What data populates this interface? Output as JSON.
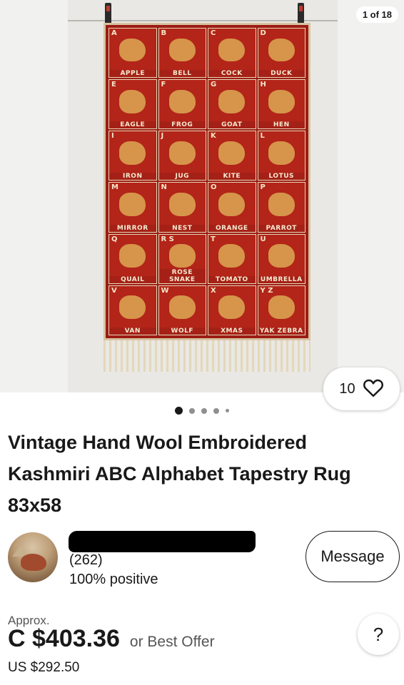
{
  "gallery": {
    "counter": "1 of 18",
    "rug_cells": [
      {
        "letter": "A",
        "word": "APPLE"
      },
      {
        "letter": "B",
        "word": "BELL"
      },
      {
        "letter": "C",
        "word": "COCK"
      },
      {
        "letter": "D",
        "word": "DUCK"
      },
      {
        "letter": "E",
        "word": "EAGLE"
      },
      {
        "letter": "F",
        "word": "FROG"
      },
      {
        "letter": "G",
        "word": "GOAT"
      },
      {
        "letter": "H",
        "word": "HEN"
      },
      {
        "letter": "I",
        "word": "IRON"
      },
      {
        "letter": "J",
        "word": "JUG"
      },
      {
        "letter": "K",
        "word": "KITE"
      },
      {
        "letter": "L",
        "word": "LOTUS"
      },
      {
        "letter": "M",
        "word": "MIRROR"
      },
      {
        "letter": "N",
        "word": "NEST"
      },
      {
        "letter": "O",
        "word": "ORANGE"
      },
      {
        "letter": "P",
        "word": "PARROT"
      },
      {
        "letter": "Q",
        "word": "QUAIL"
      },
      {
        "letter": "R S",
        "word": "ROSE SNAKE"
      },
      {
        "letter": "T",
        "word": "TOMATO"
      },
      {
        "letter": "U",
        "word": "UMBRELLA"
      },
      {
        "letter": "V",
        "word": "VAN"
      },
      {
        "letter": "W",
        "word": "WOLF"
      },
      {
        "letter": "X",
        "word": "XMAS"
      },
      {
        "letter": "Y Z",
        "word": "YAK ZEBRA"
      }
    ],
    "favorite_count": "10",
    "favorite_icon": "heart-icon",
    "dots": 5,
    "active_dot": 0
  },
  "listing": {
    "title": "Vintage Hand Wool Embroidered Kashmiri ABC Alphabet Tapestry Rug 83x58"
  },
  "seller": {
    "feedback_count": "(262)",
    "feedback_percent": "100% positive",
    "message_label": "Message"
  },
  "price": {
    "approx_label": "Approx.",
    "amount": "C $403.36",
    "offer_label": "or Best Offer",
    "usd": "US $292.50"
  },
  "help": {
    "label": "?"
  }
}
